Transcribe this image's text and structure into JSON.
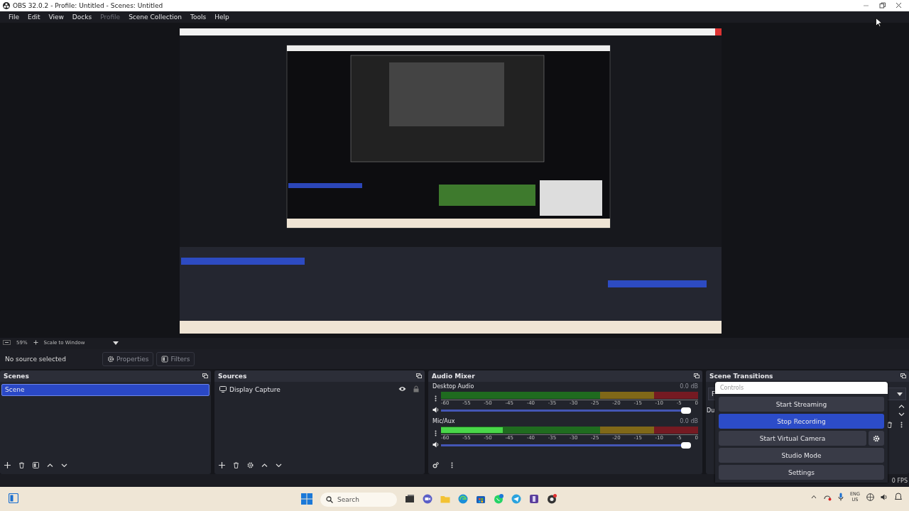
{
  "window": {
    "title": "OBS 32.0.2 - Profile: Untitled - Scenes: Untitled"
  },
  "menu": [
    {
      "label": "File",
      "disabled": false
    },
    {
      "label": "Edit",
      "disabled": false
    },
    {
      "label": "View",
      "disabled": false
    },
    {
      "label": "Docks",
      "disabled": false
    },
    {
      "label": "Profile",
      "disabled": true
    },
    {
      "label": "Scene Collection",
      "disabled": false
    },
    {
      "label": "Tools",
      "disabled": false
    },
    {
      "label": "Help",
      "disabled": false
    }
  ],
  "preview_toolbar": {
    "zoom": "59%",
    "scale_mode": "Scale to Window"
  },
  "source_toolbar": {
    "status": "No source selected",
    "buttons": [
      {
        "kind": "properties",
        "label": "Properties"
      },
      {
        "kind": "filters",
        "label": "Filters"
      }
    ]
  },
  "scenes": {
    "title": "Scenes",
    "items": [
      {
        "label": "Scene",
        "selected": true
      }
    ]
  },
  "sources": {
    "title": "Sources",
    "items": [
      {
        "label": "Display Capture",
        "visible": true
      }
    ]
  },
  "audio_mixer": {
    "title": "Audio Mixer",
    "channels": [
      {
        "name": "Desktop Audio",
        "reading": "0.0 dB",
        "meter": {
          "level": 0
        },
        "ticks": [
          "-60",
          "-55",
          "-50",
          "-45",
          "-40",
          "-35",
          "-30",
          "-25",
          "-20",
          "-15",
          "-10",
          "-5",
          "0"
        ],
        "volume": {
          "level": 1
        }
      },
      {
        "name": "Mic/Aux",
        "reading": "0.0 dB",
        "meter": {
          "level": 0.24
        },
        "ticks": [
          "-60",
          "-55",
          "-50",
          "-45",
          "-40",
          "-35",
          "-30",
          "-25",
          "-20",
          "-15",
          "-10",
          "-5",
          "0"
        ],
        "volume": {
          "level": 1
        }
      }
    ]
  },
  "scene_transitions": {
    "title": "Scene Transitions",
    "combo_text": "F",
    "duration_label": "Du"
  },
  "controls": {
    "title": "Controls",
    "buttons": [
      {
        "label": "Start Streaming",
        "active": false,
        "has_settings": false
      },
      {
        "label": "Stop Recording",
        "active": true,
        "has_settings": false
      },
      {
        "label": "Start Virtual Camera",
        "active": false,
        "has_settings": true
      },
      {
        "label": "Studio Mode",
        "active": false,
        "has_settings": false
      },
      {
        "label": "Settings",
        "active": false,
        "has_settings": false
      }
    ]
  },
  "status_bar": {
    "fps": "0 FPS"
  },
  "taskbar": {
    "search_placeholder": "Search",
    "language": "ENG",
    "region": "US"
  }
}
